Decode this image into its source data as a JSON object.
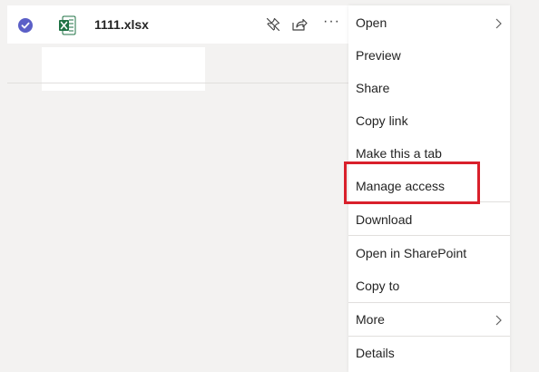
{
  "file": {
    "name": "1111.xlsx",
    "selected": true,
    "icons": [
      "check-circle-icon",
      "excel-file-icon",
      "pin-icon",
      "share-icon",
      "more-options-icon"
    ]
  },
  "menu": {
    "items": [
      {
        "label": "Open",
        "has_submenu": true
      },
      {
        "label": "Preview"
      },
      {
        "label": "Share"
      },
      {
        "label": "Copy link"
      },
      {
        "label": "Make this a tab"
      },
      {
        "label": "Manage access",
        "highlighted": true
      },
      {
        "label": "Download"
      },
      {
        "label": "Open in SharePoint"
      },
      {
        "label": "Copy to"
      },
      {
        "label": "More",
        "has_submenu": true
      },
      {
        "label": "Details"
      }
    ]
  },
  "colors": {
    "accent": "#5b5fc7",
    "excel_green": "#1f7244",
    "highlight_border": "#d9202b",
    "background": "#f3f2f1"
  }
}
